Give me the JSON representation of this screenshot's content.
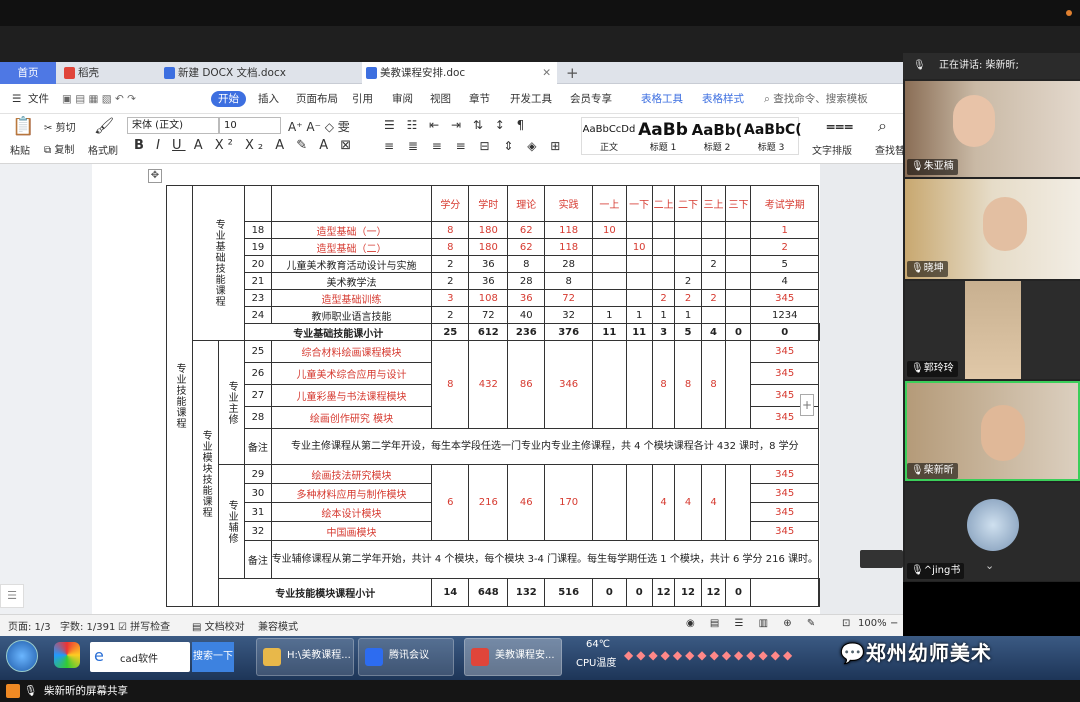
{
  "tabs": [
    "首页",
    "稻壳",
    "新建 DOCX 文档.docx",
    "美教课程安排.doc"
  ],
  "menu": [
    "文件",
    "开始",
    "插入",
    "页面布局",
    "引用",
    "审阅",
    "视图",
    "章节",
    "开发工具",
    "会员专享",
    "表格工具",
    "表格样式",
    "查找命令、搜索模板"
  ],
  "ribbon": {
    "paste": "粘贴",
    "cut": "剪切",
    "copy": "复制",
    "format_painter": "格式刷",
    "font_name": "宋体 (正文)",
    "font_size": "10",
    "styles": [
      {
        "sample": "AaBbCcDd",
        "name": "正文"
      },
      {
        "sample": "AaBb",
        "name": "标题 1"
      },
      {
        "sample": "AaBb(",
        "name": "标题 2"
      },
      {
        "sample": "AaBbC(",
        "name": "标题 3"
      }
    ],
    "text_layout": "文字排版",
    "find_replace": "查找替"
  },
  "table": {
    "header": [
      "学分",
      "学时",
      "理论",
      "实践",
      "一上",
      "一下",
      "二上",
      "二下",
      "三上",
      "三下",
      "考试学期"
    ],
    "group1_label": "专业基础技能课程",
    "outer_label": "专业技能课程",
    "rows1": [
      {
        "no": "18",
        "name": "造型基础（一）",
        "red": true,
        "credit": "8",
        "hours": "180",
        "theory": "62",
        "practice": "118",
        "terms": [
          "10",
          "",
          "",
          "",
          "",
          ""
        ],
        "exam": "1"
      },
      {
        "no": "19",
        "name": "造型基础（二）",
        "red": true,
        "credit": "8",
        "hours": "180",
        "theory": "62",
        "practice": "118",
        "terms": [
          "",
          "10",
          "",
          "",
          "",
          ""
        ],
        "exam": "2"
      },
      {
        "no": "20",
        "name": "儿童美术教育活动设计与实施",
        "red": false,
        "credit": "2",
        "hours": "36",
        "theory": "8",
        "practice": "28",
        "terms": [
          "",
          "",
          "",
          "",
          "2",
          ""
        ],
        "exam": "5"
      },
      {
        "no": "21",
        "name": "美术教学法",
        "red": false,
        "credit": "2",
        "hours": "36",
        "theory": "28",
        "practice": "8",
        "terms": [
          "",
          "",
          "",
          "2",
          "",
          ""
        ],
        "exam": "4"
      },
      {
        "no": "23",
        "name": "造型基础训练",
        "red": true,
        "credit": "3",
        "hours": "108",
        "theory": "36",
        "practice": "72",
        "terms": [
          "",
          "",
          "2",
          "2",
          "2",
          ""
        ],
        "exam": "345"
      },
      {
        "no": "24",
        "name": "教师职业语言技能",
        "red": false,
        "credit": "2",
        "hours": "72",
        "theory": "40",
        "practice": "32",
        "terms": [
          "1",
          "1",
          "1",
          "1",
          "",
          ""
        ],
        "exam": "1234"
      }
    ],
    "subtotal1": {
      "label": "专业基础技能课小计",
      "values": [
        "25",
        "612",
        "236",
        "376",
        "11",
        "11",
        "3",
        "5",
        "4",
        "0",
        "0"
      ]
    },
    "module_label": "专业模块技能课程",
    "major_label": "专业主修",
    "rows2": [
      "综合材料绘画课程模块",
      "儿童美术综合应用与设计",
      "儿童彩墨与书法课程模块",
      "绘画创作研究 模块"
    ],
    "rows2_nos": [
      "25",
      "26",
      "27",
      "28"
    ],
    "rows2_vals": {
      "credit": "8",
      "hours": "432",
      "theory": "86",
      "practice": "346",
      "t3": "8",
      "t4": "8",
      "t5": "8"
    },
    "rows2_exam": [
      "345",
      "345",
      "345",
      "345"
    ],
    "note_label": "备注",
    "note1": "专业主修课程从第二学年开设，每生本学段任选一门专业内专业主修课程，共 4 个模块课程各计 432 课时，8 学分",
    "minor_label": "专业辅修",
    "rows3": [
      "绘画技法研究模块",
      "多种材料应用与制作模块",
      "绘本设计模块",
      "中国画模块"
    ],
    "rows3_nos": [
      "29",
      "30",
      "31",
      "32"
    ],
    "rows3_vals": {
      "credit": "6",
      "hours": "216",
      "theory": "46",
      "practice": "170",
      "t3": "4",
      "t4": "4",
      "t5": "4"
    },
    "rows3_exam": [
      "345",
      "345",
      "345",
      "345"
    ],
    "note2": "专业辅修课程从第二学年开始，共计 4 个模块，每个模块 3-4 门课程。每生每学期任选 1 个模块，共计 6 学分 216 课时。",
    "subtotal2": {
      "label": "专业技能模块课程小计",
      "values": [
        "14",
        "648",
        "132",
        "516",
        "0",
        "0",
        "12",
        "12",
        "12",
        "0"
      ]
    }
  },
  "status": {
    "page": "页面: 1/3",
    "words": "字数: 1/391",
    "spell": "拼写检查",
    "proof": "文档校对",
    "compat": "兼容模式",
    "zoom": "100%"
  },
  "taskbar": {
    "search_text": "cad软件",
    "search_btn": "搜索一下",
    "items": [
      "H:\\美教课程...",
      "腾讯会议",
      "美教课程安..."
    ],
    "temp": "64℃",
    "temp_label": "CPU温度"
  },
  "share_text": "柴新昕的屏幕共享",
  "meeting": {
    "speaking": "正在讲话: 柴新昕;",
    "participants": [
      "朱亚楠",
      "晓坤",
      "郭玲玲",
      "柴新昕",
      "^jing书"
    ]
  },
  "watermark": "郑州幼师美术"
}
